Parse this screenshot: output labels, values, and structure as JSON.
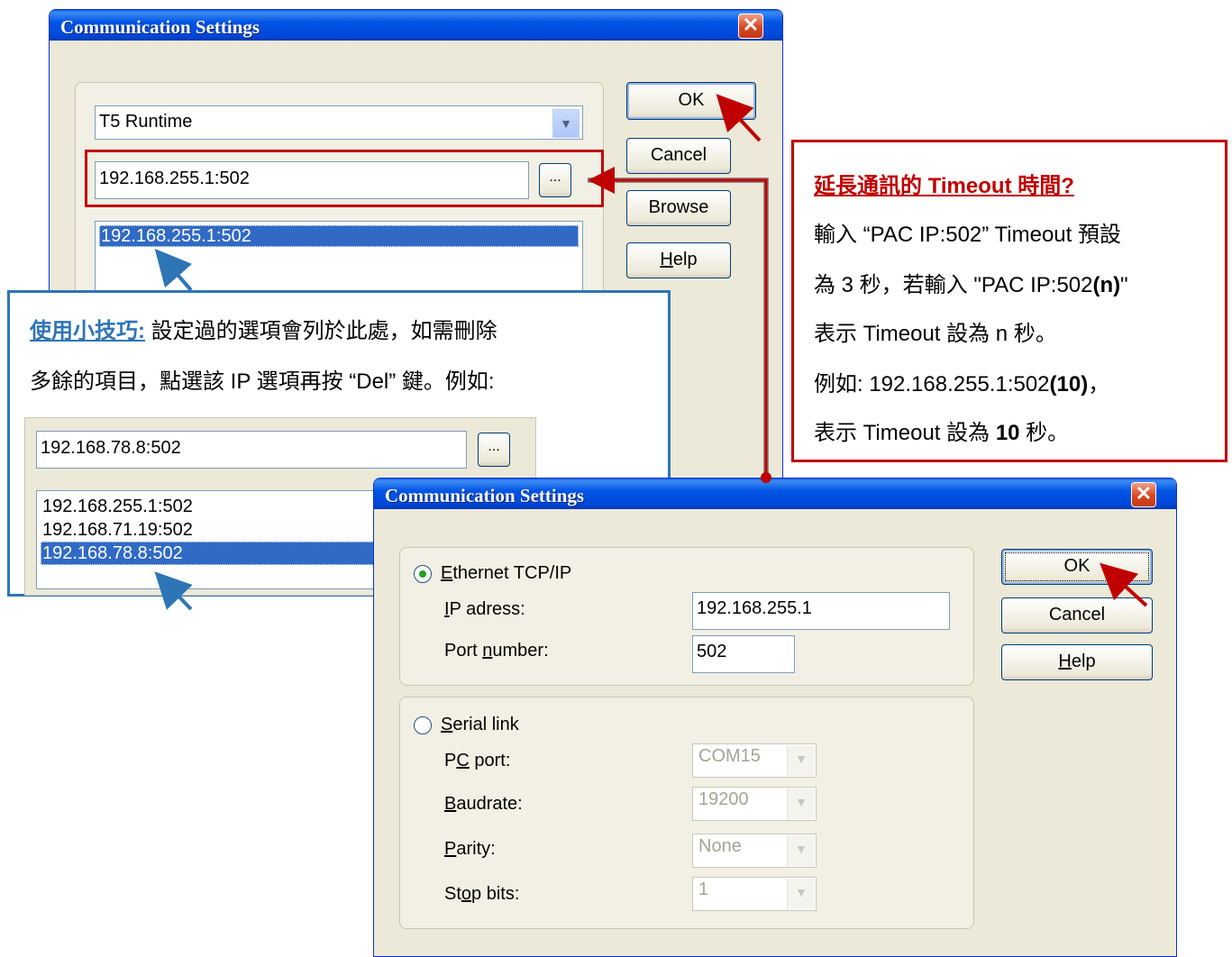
{
  "dialog1": {
    "title": "Communication Settings",
    "driver_select": "T5 Runtime",
    "address_value": "192.168.255.1:502",
    "browse_dots": "...",
    "list_items": [
      "192.168.255.1:502"
    ],
    "buttons": {
      "ok": "OK",
      "cancel": "Cancel",
      "browse": "Browse",
      "help_prefix": "",
      "help_key": "H",
      "help_rest": "elp"
    }
  },
  "tip": {
    "heading": "使用小技巧:",
    "line1_rest": " 設定過的選項會列於此處，如需刪除",
    "line2": "多餘的項目，點選該  IP 選項再按 “Del” 鍵。例如:",
    "example_input": "192.168.78.8:502",
    "example_dots": "...",
    "example_list": [
      "192.168.255.1:502",
      "192.168.71.19:502",
      "192.168.78.8:502"
    ]
  },
  "timeout_note": {
    "heading": "延長通訊的 Timeout 時間?",
    "line1": "輸入 “PAC IP:502” Timeout 預設",
    "line2_a": "為 3 秒，若輸入 \"PAC IP:502",
    "line2_b": "(n)",
    "line2_c": "\"",
    "line3": "表示 Timeout 設為 n 秒。",
    "line4_a": "例如: 192.168.255.1:502",
    "line4_b": "(10)",
    "line4_c": "，",
    "line5_a": "表示 Timeout 設為 ",
    "line5_b": "10",
    "line5_c": " 秒。"
  },
  "dialog2": {
    "title": "Communication Settings",
    "ethernet": {
      "key": "E",
      "rest": "thernet TCP/IP"
    },
    "ip_label": {
      "key": "I",
      "rest": "P adress:"
    },
    "ip_value": "192.168.255.1",
    "port_label": {
      "pre": "Port ",
      "key": "n",
      "rest": "umber:"
    },
    "port_value": "502",
    "serial": {
      "key": "S",
      "rest": "erial link"
    },
    "pc_port": {
      "pre": "P",
      "key": "C",
      "rest": " port:",
      "value": "COM15"
    },
    "baudrate": {
      "key": "B",
      "rest": "audrate:",
      "value": "19200"
    },
    "parity": {
      "key": "P",
      "rest": "arity:",
      "value": "None"
    },
    "stop_bits": {
      "pre": "St",
      "key": "o",
      "rest": "p bits:",
      "value": "1"
    },
    "buttons": {
      "ok": "OK",
      "cancel": "Cancel",
      "help_key": "H",
      "help_rest": "elp"
    }
  },
  "colors": {
    "title_blue": "#0055e5",
    "accent_red": "#c00000",
    "accent_blue": "#2e75b6",
    "selection": "#316ac5"
  }
}
